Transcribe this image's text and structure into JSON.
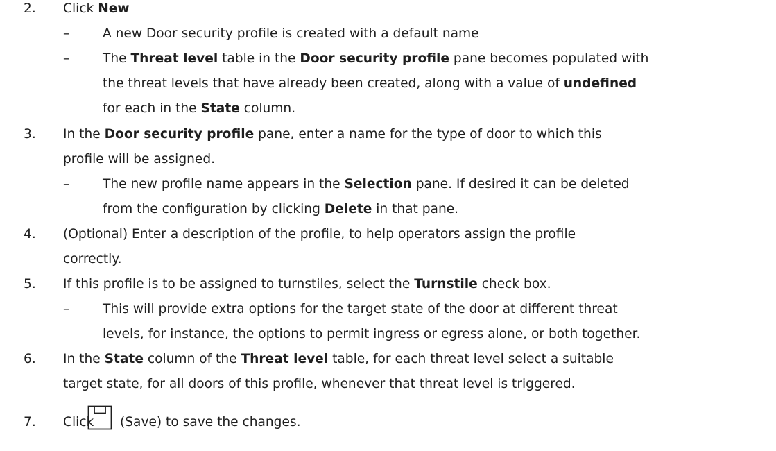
{
  "step2": {
    "num": "2.",
    "pre": "Click ",
    "new_label": "New",
    "bullet1": "A new Door security profile is created with a default name",
    "bullet2": {
      "the": "The ",
      "threat_level": "Threat level",
      "table_in_the": " table in the ",
      "door_security_profile": "Door security profile",
      "pane_becomes": " pane becomes populated with",
      "line2a": "the threat levels that have already been created, along with a value of ",
      "undefined": "undefined",
      "for_each": "for each in the ",
      "state": "State",
      "column": " column."
    }
  },
  "step3": {
    "num": "3.",
    "in_the": "In the ",
    "door_security_profile": "Door security profile",
    "rest1": " pane, enter a name for the type of door to which this",
    "line2": "profile will be assigned.",
    "bullet": {
      "pre": "The new profile name appears in the ",
      "selection": "Selection",
      "post": " pane. If desired it can be deleted",
      "line2a": "from the configuration by clicking ",
      "delete": "Delete",
      "line2b": " in that pane."
    }
  },
  "step4": {
    "num": "4.",
    "line1": "(Optional) Enter a description of the profile, to help operators assign the profile",
    "line2": "correctly."
  },
  "step5": {
    "num": "5.",
    "pre": "If this profile is to be assigned to turnstiles, select the ",
    "turnstile": "Turnstile",
    "post": " check box.",
    "bullet_line1": "This will provide extra options for the target state of the door at different threat",
    "bullet_line2": "levels, for instance, the options to permit ingress or egress alone, or both together."
  },
  "step6": {
    "num": "6.",
    "in_the": "In the ",
    "state": "State",
    "column_of": " column of the ",
    "threat_level": "Threat level",
    "rest": " table, for each threat level select a suitable",
    "line2": "target state, for all doors of this profile, whenever that threat level is triggered."
  },
  "step7": {
    "num": "7.",
    "click": "Click",
    "icon": "save-icon",
    "post": "(Save) to save the changes."
  },
  "dash_char": "–"
}
